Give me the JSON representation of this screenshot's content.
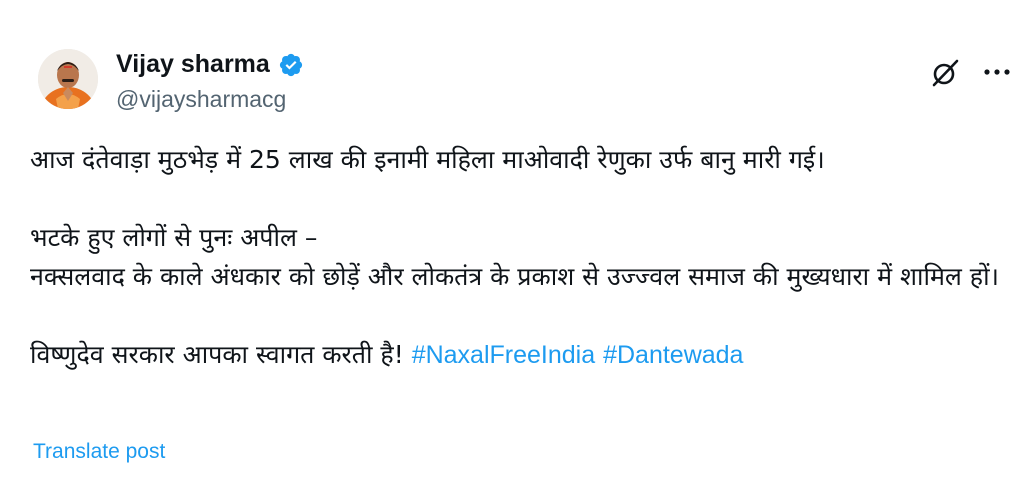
{
  "author": {
    "display_name": "Vijay sharma",
    "handle": "@vijaysharmacg",
    "verified": true,
    "avatar_icon": "profile-photo"
  },
  "actions": {
    "grok_icon": "grok-icon",
    "more_icon": "more-options-icon"
  },
  "post": {
    "line1": "आज दंतेवाड़ा मुठभेड़ में 25 लाख की इनामी महिला माओवादी रेणुका उर्फ बानु मारी गई।",
    "line2": "भटके हुए लोगों से पुनः अपील –",
    "line3": "नक्सलवाद के काले अंधकार को छोड़ें और लोकतंत्र के प्रकाश से उज्ज्वल समाज की मुख्यधारा में शामिल हों।",
    "line4_text": "विष्णुदेव सरकार आपका स्वागत करती है! ",
    "hashtags": [
      "#NaxalFreeIndia",
      "#Dantewada"
    ]
  },
  "translate_label": "Translate post",
  "colors": {
    "accent": "#1d9bf0",
    "text": "#0f1419",
    "secondary": "#536471"
  }
}
